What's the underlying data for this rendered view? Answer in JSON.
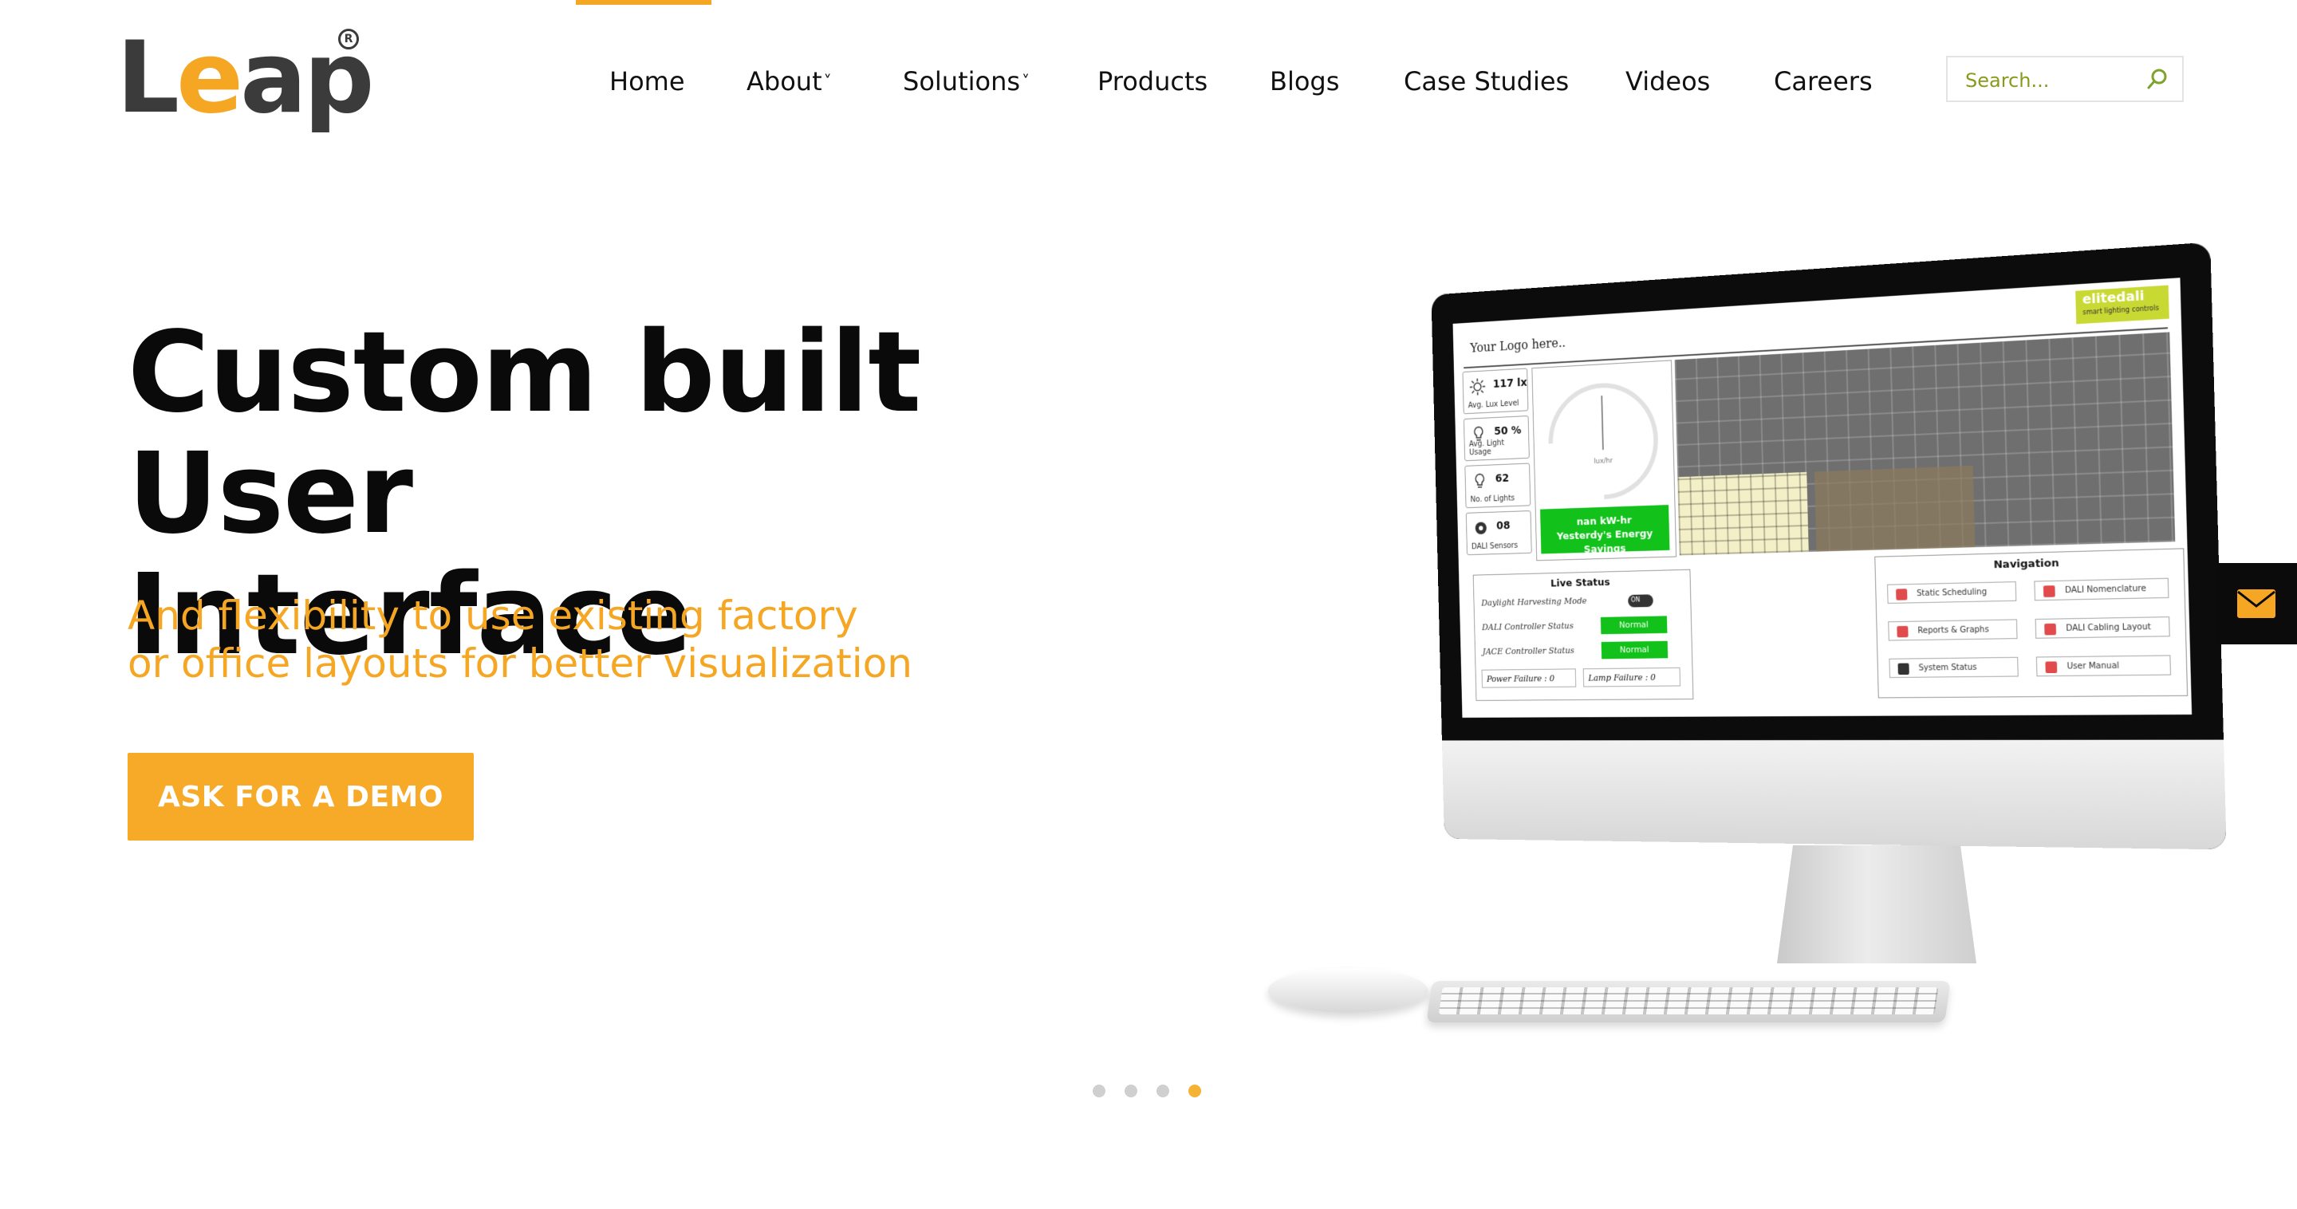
{
  "brand": {
    "logo_text_l": "L",
    "logo_text_e": "e",
    "logo_text_ap": "ap",
    "registered": "R"
  },
  "nav": {
    "items": [
      {
        "label": "Home",
        "has_dropdown": false,
        "active": true
      },
      {
        "label": "About",
        "has_dropdown": true
      },
      {
        "label": "Solutions",
        "has_dropdown": true
      },
      {
        "label": "Products",
        "has_dropdown": false
      },
      {
        "label": "Blogs",
        "has_dropdown": false
      },
      {
        "label": "Case Studies",
        "has_dropdown": false
      },
      {
        "label": "Videos",
        "has_dropdown": false
      },
      {
        "label": "Careers",
        "has_dropdown": false
      }
    ],
    "chevron": "˅"
  },
  "search": {
    "placeholder": "Search...",
    "icon": "search-icon"
  },
  "hero": {
    "title_line1": "Custom built User",
    "title_line2": "Interface",
    "subtitle_line1": "And flexibility to use existing factory",
    "subtitle_line2": "or office layouts for better visualization",
    "cta_label": "ASK FOR A DEMO"
  },
  "floating": {
    "icon": "mail-icon"
  },
  "carousel": {
    "total": 4,
    "active_index": 3
  },
  "dashboard": {
    "logo_placeholder": "Your Logo here..",
    "brand_name": "elitedali",
    "brand_tagline": "smart lighting controls",
    "stats": [
      {
        "value": "117 lx",
        "label": "Avg. Lux Level"
      },
      {
        "value": "50 %",
        "label": "Avg. Light Usage"
      },
      {
        "value": "62",
        "label": "No. of Lights"
      },
      {
        "value": "08",
        "label": "DALI Sensors"
      }
    ],
    "gauge_unit": "lux/hr",
    "energy_value": "nan kW-hr",
    "energy_label": "Yesterdy's Energy Savings",
    "live_status": {
      "title": "Live Status",
      "daylight_mode": "Daylight Harvesting Mode",
      "toggle_text": "ON",
      "dali_status_label": "DALI Controller Status",
      "dali_status_value": "Normal",
      "jace_status_label": "JACE Controller Status",
      "jace_status_value": "Normal",
      "power_failure": "Power Failure : 0",
      "lamp_failure": "Lamp Failure : 0"
    },
    "navigation": {
      "title": "Navigation",
      "items": [
        "Static Scheduling",
        "DALI Nomenclature",
        "Reports & Graphs",
        "DALI Cabling Layout",
        "System Status",
        "User Manual"
      ]
    },
    "colors": {
      "status_green": "#12c21b",
      "brand_lime": "#c9d933"
    }
  },
  "colors": {
    "accent": "#f5a623",
    "text": "#0a0a0a",
    "search_text": "#8a9a1a"
  }
}
